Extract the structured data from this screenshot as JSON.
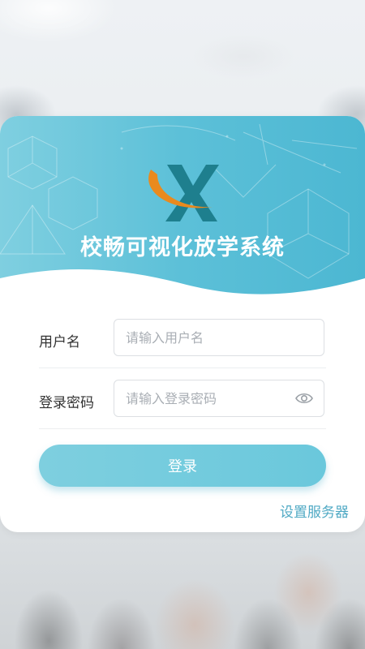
{
  "app": {
    "title": "校畅可视化放学系统"
  },
  "form": {
    "username": {
      "label": "用户名",
      "placeholder": "请输入用户名",
      "value": ""
    },
    "password": {
      "label": "登录密码",
      "placeholder": "请输入登录密码",
      "value": ""
    }
  },
  "actions": {
    "login_label": "登录",
    "server_settings_label": "设置服务器"
  },
  "icons": {
    "logo": "x-letter-logo",
    "password_toggle": "eye-icon"
  },
  "colors": {
    "header": "#5cc0d8",
    "button": "#72cadd",
    "link": "#4fa9c4",
    "logo_dark": "#1e7f8e",
    "logo_orange": "#e98a1e"
  }
}
